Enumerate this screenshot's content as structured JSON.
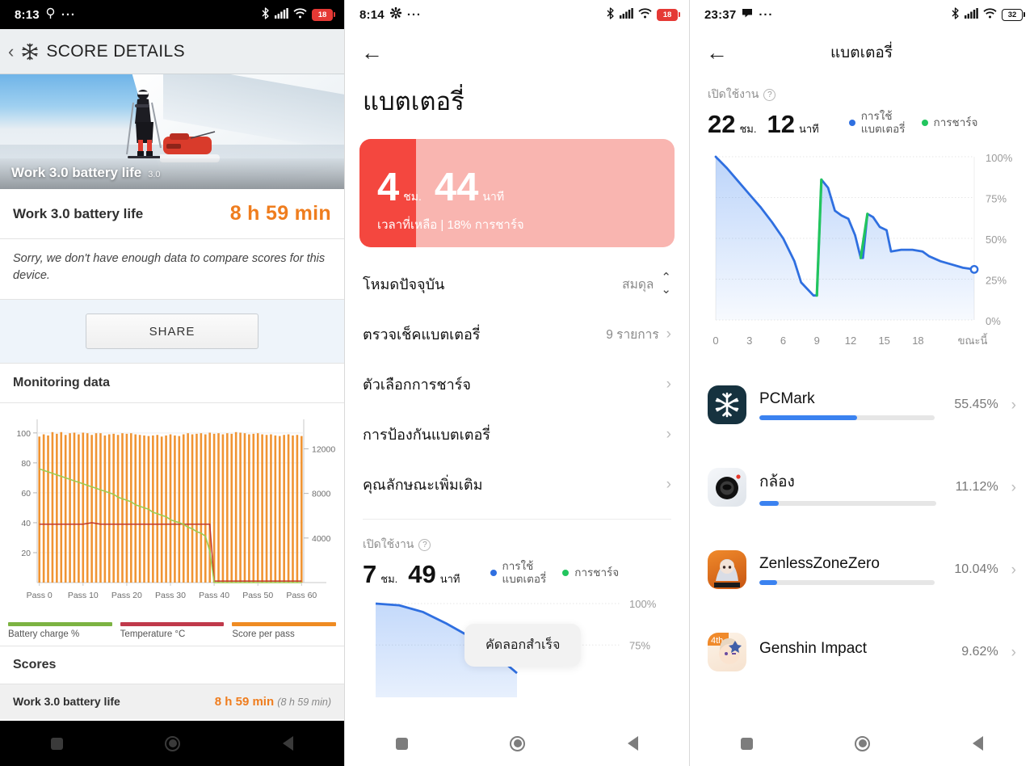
{
  "panel1": {
    "statusbar": {
      "time": "8:13",
      "icons": [
        "location-icon",
        "more-icon",
        "bluetooth-icon",
        "signal-icon",
        "wifi-icon"
      ],
      "battery": "18"
    },
    "header": {
      "title": "SCORE DETAILS",
      "back_icon": "back-chevron-icon",
      "app_icon": "snowflake-icon"
    },
    "banner": {
      "title": "Work 3.0 battery life",
      "version": "3.0"
    },
    "score_row": {
      "label": "Work 3.0 battery life",
      "value": "8 h 59 min"
    },
    "note": "Sorry, we don't have enough data to compare scores for this device.",
    "share_label": "SHARE",
    "monitoring_title": "Monitoring data",
    "legend": [
      {
        "label": "Battery charge %",
        "color": "#7cb342"
      },
      {
        "label": "Temperature °C",
        "color": "#c0394b"
      },
      {
        "label": "Score per pass",
        "color": "#ef8b22"
      }
    ],
    "scores_title": "Scores",
    "score_item": {
      "name": "Work 3.0 battery life",
      "value": "8 h 59 min",
      "paren": "(8 h 59 min)"
    }
  },
  "panel2": {
    "statusbar": {
      "time": "8:14",
      "icons": [
        "gear-icon",
        "more-icon",
        "bluetooth-icon",
        "signal-icon",
        "wifi-icon"
      ],
      "battery": "18"
    },
    "title": "แบตเตอรี่",
    "back_icon": "back-arrow-icon",
    "battery_card": {
      "hours": "4",
      "hours_unit": "ชม.",
      "minutes": "44",
      "minutes_unit": "นาที",
      "subtitle": "เวลาที่เหลือ | 18% การชาร์จ",
      "fill_percent": 18,
      "fill_color": "#f4473f",
      "bg_color": "#f9b5b0"
    },
    "menu": [
      {
        "label": "โหมดปัจจุบัน",
        "value": "สมดุล",
        "indicator": "updown"
      },
      {
        "label": "ตรวจเช็คแบตเตอรี่",
        "value": "9 รายการ",
        "indicator": "chevron"
      },
      {
        "label": "ตัวเลือกการชาร์จ",
        "value": "",
        "indicator": "chevron"
      },
      {
        "label": "การป้องกันแบตเตอรี่",
        "value": "",
        "indicator": "chevron"
      },
      {
        "label": "คุณลักษณะเพิ่มเติม",
        "value": "",
        "indicator": "chevron"
      }
    ],
    "usage": {
      "label": "เปิดใช้งาน",
      "hours": "7",
      "hours_unit": "ชม.",
      "minutes": "49",
      "minutes_unit": "นาที",
      "legend": [
        {
          "label": "การใช้\nแบตเตอรี่",
          "color": "#2f6fe0"
        },
        {
          "label": "การชาร์จ",
          "color": "#22c55e"
        }
      ],
      "ytick_100": "100%",
      "ytick_75": "75%"
    },
    "toast": "คัดลอกสำเร็จ"
  },
  "panel3": {
    "statusbar": {
      "time": "23:37",
      "icons": [
        "chat-icon",
        "more-icon",
        "bluetooth-icon",
        "signal-icon",
        "wifi-icon"
      ],
      "battery": "32"
    },
    "title": "แบตเตอรี่",
    "back_icon": "back-arrow-icon",
    "usage": {
      "label": "เปิดใช้งาน",
      "hours": "22",
      "hours_unit": "ชม.",
      "minutes": "12",
      "minutes_unit": "นาที",
      "legend": [
        {
          "label": "การใช้\nแบตเตอรี่",
          "color": "#2f6fe0"
        },
        {
          "label": "การชาร์จ",
          "color": "#22c55e"
        }
      ]
    },
    "apps": [
      {
        "name": "PCMark",
        "percent": "55.45%",
        "bar": 55.45,
        "icon": "pcmark-snowflake-icon"
      },
      {
        "name": "กล้อง",
        "percent": "11.12%",
        "bar": 11.12,
        "icon": "camera-app-icon"
      },
      {
        "name": "ZenlessZoneZero",
        "percent": "10.04%",
        "bar": 10.04,
        "icon": "zenless-zone-zero-icon"
      },
      {
        "name": "Genshin Impact",
        "percent": "9.62%",
        "bar": 9.62,
        "icon": "genshin-impact-icon"
      }
    ]
  },
  "chart_data": [
    {
      "type": "bar",
      "title": "Monitoring data",
      "xlabel": "",
      "ylabel": "Battery charge %",
      "xtick_labels": [
        "Pass 0",
        "Pass 10",
        "Pass 20",
        "Pass 30",
        "Pass 40",
        "Pass 50",
        "Pass 60"
      ],
      "ytick_left": [
        20,
        40,
        60,
        80,
        100
      ],
      "ytick_right": [
        4000,
        8000,
        12000
      ],
      "ylim": [
        0,
        108
      ],
      "y2lim": [
        0,
        14500
      ],
      "grid": true,
      "legend_position": "bottom",
      "series": [
        {
          "name": "Score per pass",
          "type": "bar",
          "color": "#ef8b22",
          "axis": "right",
          "values": [
            13100,
            13300,
            13200,
            13500,
            13350,
            13500,
            13250,
            13400,
            13450,
            13300,
            13450,
            13400,
            13250,
            13400,
            13400,
            13200,
            13300,
            13350,
            13250,
            13400,
            13350,
            13400,
            13300,
            13250,
            13200,
            13150,
            13200,
            13250,
            13100,
            13200,
            13300,
            13200,
            13150,
            13300,
            13400,
            13300,
            13350,
            13400,
            13300,
            13450,
            13350,
            13400,
            13300,
            13400,
            13350,
            13500,
            13450,
            13400,
            13300,
            13350,
            13400,
            13300,
            13250,
            13300,
            13200,
            13150,
            13250,
            13300,
            13200,
            13250,
            13150
          ]
        },
        {
          "name": "Battery charge %",
          "type": "line",
          "color": "#9ccc52",
          "axis": "left",
          "values": [
            76,
            75,
            74,
            73,
            72,
            71,
            70,
            69,
            68,
            67,
            66,
            65,
            64,
            63,
            62,
            61,
            60,
            59,
            57,
            56,
            55,
            54,
            52,
            51,
            50,
            49,
            47,
            46,
            45,
            44,
            42,
            41,
            40,
            39,
            37,
            36,
            34,
            33,
            31,
            21,
            0,
            0,
            0,
            0,
            0,
            0,
            0,
            0,
            0,
            0,
            0,
            0,
            0,
            0,
            0,
            0,
            0,
            0,
            0,
            0,
            0
          ]
        },
        {
          "name": "Temperature °C",
          "type": "line",
          "color": "#c0392b",
          "axis": "left",
          "values": [
            39,
            39,
            39,
            39,
            39,
            39,
            39,
            39,
            39,
            39,
            39,
            39.5,
            40,
            39.5,
            39,
            39,
            39,
            39,
            39,
            39,
            39,
            39,
            39,
            39,
            39,
            39,
            39,
            39,
            39,
            39,
            39,
            39,
            39,
            39,
            39,
            39,
            39,
            39,
            39,
            39,
            1,
            1,
            1,
            1,
            1,
            1,
            1,
            1,
            1,
            1,
            1,
            1,
            1,
            1,
            1,
            1,
            1,
            1,
            1,
            1,
            1
          ]
        }
      ]
    },
    {
      "type": "area",
      "title": "",
      "panel": "panel3-battery-history",
      "xlabel": "",
      "ylabel": "%",
      "xtick_labels": [
        "0",
        "3",
        "6",
        "9",
        "12",
        "15",
        "18",
        "ขณะนี้"
      ],
      "ytick_labels": [
        "0%",
        "25%",
        "50%",
        "75%",
        "100%"
      ],
      "ylim": [
        0,
        100
      ],
      "xlim": [
        0,
        23
      ],
      "grid": true,
      "series": [
        {
          "name": "การใช้แบตเตอรี่",
          "color": "#2f6fe0",
          "x": [
            0,
            1,
            2,
            3,
            4,
            5,
            6,
            7,
            7.6,
            8.7,
            9.0,
            9.4,
            10,
            10.6,
            11.2,
            11.8,
            12.4,
            12.9,
            13.1,
            13.5,
            14,
            14.6,
            15.2,
            15.6,
            16.5,
            17.5,
            18.4,
            19,
            20,
            21,
            22,
            23
          ],
          "y": [
            100,
            93,
            85,
            77,
            69,
            60,
            50,
            36,
            23,
            15,
            15,
            86,
            81,
            67,
            64,
            62,
            52,
            38,
            38,
            65,
            63,
            57,
            55,
            42,
            43,
            43,
            42,
            39,
            36,
            34,
            32,
            31
          ]
        },
        {
          "name": "การชาร์จ",
          "color": "#22c55e",
          "segments": [
            {
              "x": [
                9.0,
                9.4
              ],
              "y": [
                15,
                86
              ]
            },
            {
              "x": [
                12.9,
                13.5
              ],
              "y": [
                38,
                65
              ]
            }
          ]
        }
      ],
      "marker": {
        "x": 23,
        "y": 31
      }
    },
    {
      "type": "area",
      "panel": "panel2-battery-history",
      "ytick_labels": [
        "75%",
        "100%"
      ],
      "series": [
        {
          "name": "การใช้แบตเตอรี่",
          "color": "#2f6fe0",
          "x": [
            0,
            1,
            2,
            3,
            4,
            5,
            6
          ],
          "y": [
            100,
            99,
            95,
            88,
            80,
            70,
            58
          ]
        }
      ]
    }
  ]
}
